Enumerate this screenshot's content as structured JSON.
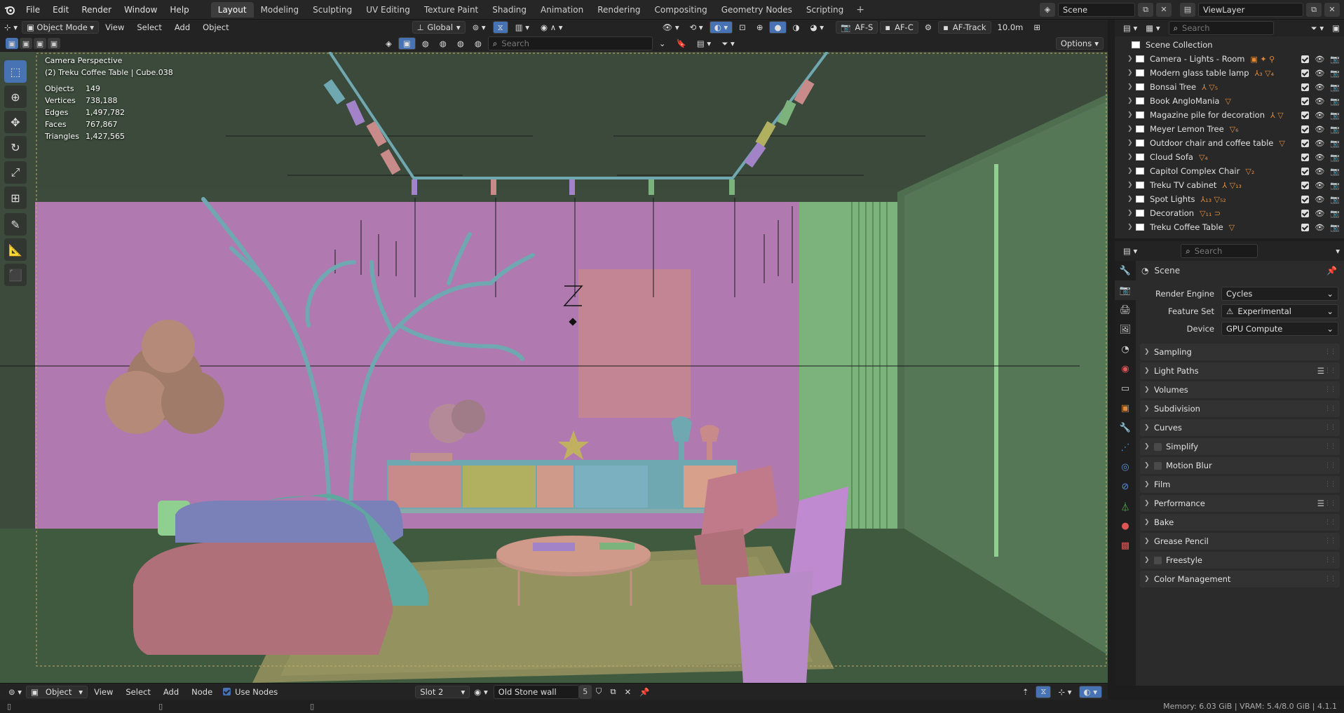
{
  "topbar": {
    "menus": [
      "File",
      "Edit",
      "Render",
      "Window",
      "Help"
    ],
    "workspaces": [
      "Layout",
      "Modeling",
      "Sculpting",
      "UV Editing",
      "Texture Paint",
      "Shading",
      "Animation",
      "Rendering",
      "Compositing",
      "Geometry Nodes",
      "Scripting"
    ],
    "active_workspace": "Layout",
    "scene_name": "Scene",
    "view_layer": "ViewLayer"
  },
  "viewport_header": {
    "mode": "Object Mode",
    "menus": [
      "View",
      "Select",
      "Add",
      "Object"
    ],
    "orientation": "Global",
    "af_s": "AF-S",
    "af_c": "AF-C",
    "af_track": "AF-Track",
    "distance": "10.0m",
    "search_placeholder": "Search",
    "options": "Options"
  },
  "overlay": {
    "camera": "Camera Perspective",
    "object": "(2) Treku Coffee Table | Cube.038",
    "stats": [
      {
        "label": "Objects",
        "value": "149"
      },
      {
        "label": "Vertices",
        "value": "738,188"
      },
      {
        "label": "Edges",
        "value": "1,497,782"
      },
      {
        "label": "Faces",
        "value": "767,867"
      },
      {
        "label": "Triangles",
        "value": "1,427,565"
      }
    ]
  },
  "outliner": {
    "search_placeholder": "Search",
    "root": "Scene Collection",
    "items": [
      {
        "label": "Camera - Lights - Room",
        "icons": "▣ ✦ ⚲"
      },
      {
        "label": "Modern glass table lamp",
        "icons": "⅄₃ ▽₄"
      },
      {
        "label": "Bonsai Tree",
        "icons": "⅄ ▽₅"
      },
      {
        "label": "Book AngloMania",
        "icons": "▽"
      },
      {
        "label": "Magazine pile for decoration",
        "icons": "⅄ ▽"
      },
      {
        "label": "Meyer Lemon Tree",
        "icons": "▽₆"
      },
      {
        "label": "Outdoor chair and coffee table",
        "icons": "▽"
      },
      {
        "label": "Cloud Sofa",
        "icons": "▽₄"
      },
      {
        "label": "Capitol Complex Chair",
        "icons": "▽₂"
      },
      {
        "label": "Treku TV cabinet",
        "icons": "⅄ ▽₁₃"
      },
      {
        "label": "Spot Lights",
        "icons": "⅄₁₃ ▽₅₂"
      },
      {
        "label": "Decoration",
        "icons": "▽₁₁ ⊃"
      },
      {
        "label": "Treku Coffee Table",
        "icons": "▽"
      }
    ]
  },
  "properties": {
    "search_placeholder": "Search",
    "context": "Scene",
    "render_engine_label": "Render Engine",
    "render_engine": "Cycles",
    "feature_set_label": "Feature Set",
    "feature_set": "Experimental",
    "device_label": "Device",
    "device": "GPU Compute",
    "panels": [
      {
        "label": "Sampling",
        "checkbox": false,
        "list": false
      },
      {
        "label": "Light Paths",
        "checkbox": false,
        "list": true
      },
      {
        "label": "Volumes",
        "checkbox": false,
        "list": false
      },
      {
        "label": "Subdivision",
        "checkbox": false,
        "list": false
      },
      {
        "label": "Curves",
        "checkbox": false,
        "list": false
      },
      {
        "label": "Simplify",
        "checkbox": true,
        "list": false
      },
      {
        "label": "Motion Blur",
        "checkbox": true,
        "list": false
      },
      {
        "label": "Film",
        "checkbox": false,
        "list": false
      },
      {
        "label": "Performance",
        "checkbox": false,
        "list": true
      },
      {
        "label": "Bake",
        "checkbox": false,
        "list": false
      },
      {
        "label": "Grease Pencil",
        "checkbox": false,
        "list": false
      },
      {
        "label": "Freestyle",
        "checkbox": true,
        "list": false
      },
      {
        "label": "Color Management",
        "checkbox": false,
        "list": false
      }
    ]
  },
  "shader_header": {
    "type": "Object",
    "menus": [
      "View",
      "Select",
      "Add",
      "Node"
    ],
    "use_nodes": "Use Nodes",
    "slot": "Slot 2",
    "material": "Old Stone wall",
    "users": "5"
  },
  "statusbar": {
    "memory": "Memory: 6.03 GiB | VRAM: 5.4/8.0 GiB | 4.1.1"
  }
}
